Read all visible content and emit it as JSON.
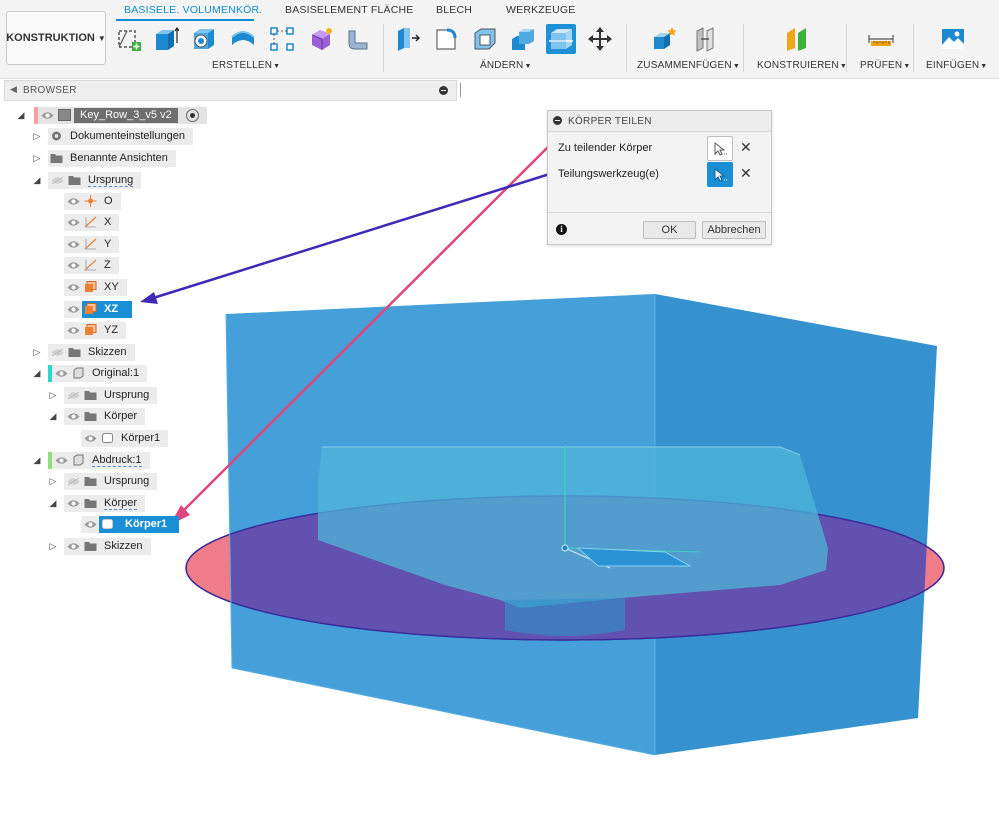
{
  "workspace": {
    "label": "KONSTRUKTION"
  },
  "tabs": [
    {
      "label": "BASISELE. VOLUMENKÖR.",
      "active": true
    },
    {
      "label": "BASISELEMENT FLÄCHE"
    },
    {
      "label": "BLECH"
    },
    {
      "label": "WERKZEUGE"
    }
  ],
  "groups": {
    "erstellen": "ERSTELLEN",
    "aendern": "ÄNDERN",
    "zusammenfuegen": "ZUSAMMENFÜGEN",
    "konstruieren": "KONSTRUIEREN",
    "pruefen": "PRÜFEN",
    "einfuegen": "EINFÜGEN"
  },
  "tools": {
    "erstellen": [
      "create-sketch-icon",
      "extrude-icon",
      "revolve-icon",
      "sweep-icon",
      "rectangular-pattern-icon",
      "form-icon",
      "pipe-icon"
    ],
    "aendern": [
      "press-pull-icon",
      "fillet-icon",
      "shell-icon",
      "combine-icon",
      "split-body-icon",
      "move-copy-icon"
    ],
    "zusammenfuegen": [
      "new-component-icon",
      "joint-icon"
    ],
    "konstruieren": [
      "offset-plane-icon"
    ],
    "pruefen": [
      "measure-icon"
    ],
    "einfuegen": [
      "insert-image-icon"
    ]
  },
  "browser": {
    "title": "BROWSER",
    "root": "Key_Row_3_v5 v2",
    "items": {
      "dokumenteinstellungen": "Dokumenteinstellungen",
      "benannte_ansichten": "Benannte Ansichten",
      "ursprung": "Ursprung",
      "o": "O",
      "x": "X",
      "y": "Y",
      "z": "Z",
      "xy": "XY",
      "xz": "XZ",
      "yz": "YZ",
      "skizzen": "Skizzen",
      "original": "Original:1",
      "original_ursprung": "Ursprung",
      "original_koerper": "Körper",
      "original_koerper1": "Körper1",
      "abdruck": "Abdruck:1",
      "abdruck_ursprung": "Ursprung",
      "abdruck_koerper": "Körper",
      "abdruck_koerper1": "Körper1",
      "abdruck_skizzen": "Skizzen"
    }
  },
  "dialog": {
    "title": "KÖRPER TEILEN",
    "field1_label": "Zu teilender Körper",
    "field2_label": "Teilungswerkzeug(e)",
    "ok": "OK",
    "cancel": "Abbrechen"
  },
  "colors": {
    "accent": "#0e8ed4",
    "selection": "#1a8fd6",
    "body_fill": "#2b93d4",
    "plane_fill": "#f07c8a",
    "plane_overlap": "#6a5db0",
    "arrow_pink": "#e0457f",
    "arrow_purple": "#3b2bb5",
    "original_marker": "#2fd6c9",
    "abdruck_marker": "#8fe07a",
    "root_marker": "#f3a0a8"
  }
}
